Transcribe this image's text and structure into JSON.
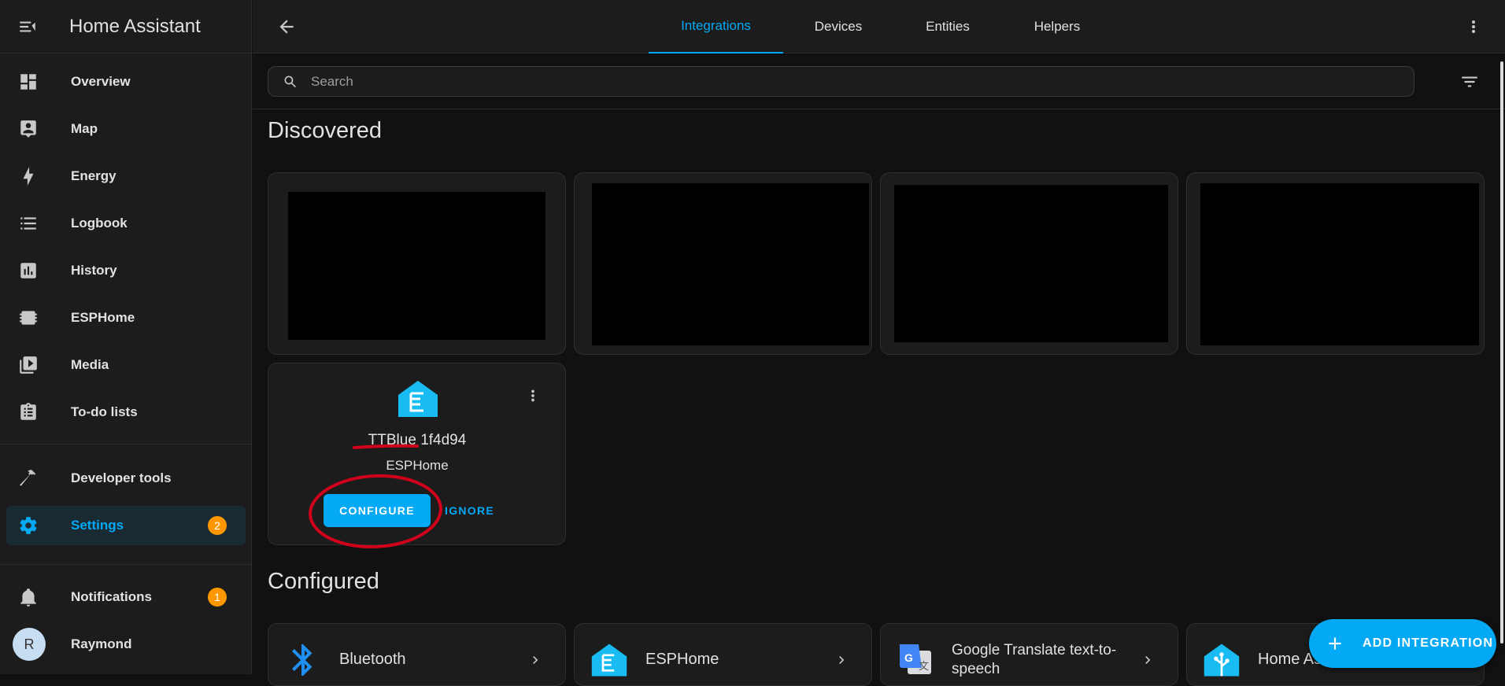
{
  "sidebar": {
    "title": "Home Assistant",
    "items": [
      {
        "label": "Overview",
        "icon": "dashboard-icon"
      },
      {
        "label": "Map",
        "icon": "map-icon"
      },
      {
        "label": "Energy",
        "icon": "lightning-icon"
      },
      {
        "label": "Logbook",
        "icon": "list-icon"
      },
      {
        "label": "History",
        "icon": "chart-icon"
      },
      {
        "label": "ESPHome",
        "icon": "chip-icon"
      },
      {
        "label": "Media",
        "icon": "play-box-icon"
      },
      {
        "label": "To-do lists",
        "icon": "clipboard-list-icon"
      },
      {
        "label": "Developer tools",
        "icon": "hammer-icon"
      },
      {
        "label": "Settings",
        "icon": "gear-icon",
        "badge": "2",
        "active": true
      },
      {
        "label": "Notifications",
        "icon": "bell-icon",
        "badge": "1"
      }
    ],
    "user": {
      "initial": "R",
      "name": "Raymond"
    }
  },
  "topbar": {
    "tabs": [
      "Integrations",
      "Devices",
      "Entities",
      "Helpers"
    ],
    "active_tab": "Integrations"
  },
  "search": {
    "placeholder": "Search"
  },
  "sections": {
    "discovered": "Discovered",
    "configured": "Configured"
  },
  "discovered_card": {
    "name": "TTBlue 1f4d94",
    "domain": "ESPHome",
    "configure_label": "CONFIGURE",
    "ignore_label": "IGNORE"
  },
  "configured_cards": [
    {
      "name": "Bluetooth",
      "icon": "bluetooth-icon"
    },
    {
      "name": "ESPHome",
      "icon": "esphome-icon"
    },
    {
      "name": "Google Translate text-to-speech",
      "icon": "google-translate-icon"
    },
    {
      "name": "Home Assistant Supervisor",
      "icon": "home-assistant-icon"
    }
  ],
  "fab": {
    "label": "ADD INTEGRATION"
  },
  "colors": {
    "accent": "#03a9f4",
    "badge": "#ff9800",
    "annotation": "#d0021b"
  }
}
